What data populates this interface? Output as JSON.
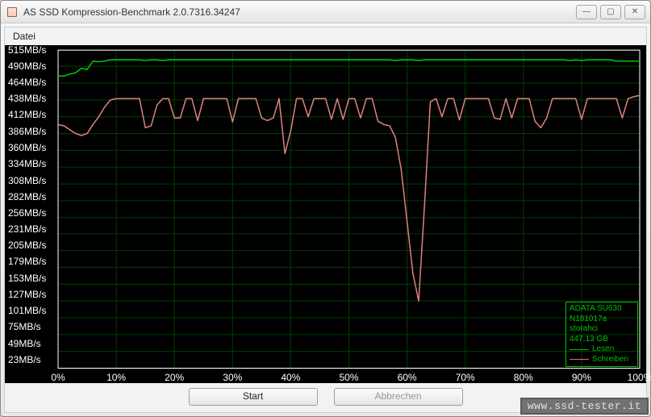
{
  "window": {
    "title": "AS SSD Kompression-Benchmark 2.0.7316.34247"
  },
  "menubar": {
    "items": [
      "Datei"
    ]
  },
  "buttons": {
    "start": "Start",
    "abort": "Abbrechen"
  },
  "legend": {
    "device": "ADATA SU630",
    "firmware": "N181017a",
    "driver": "storahci",
    "capacity": "447,13 GB",
    "read": "Lesen",
    "write": "Schreiben"
  },
  "watermark": "www.ssd-tester.it",
  "chart_data": {
    "type": "line",
    "xlabel": "",
    "ylabel": "",
    "x_ticks": [
      "0%",
      "10%",
      "20%",
      "30%",
      "40%",
      "50%",
      "60%",
      "70%",
      "80%",
      "90%",
      "100%"
    ],
    "y_ticks": [
      "23MB/s",
      "49MB/s",
      "75MB/s",
      "101MB/s",
      "127MB/s",
      "153MB/s",
      "179MB/s",
      "205MB/s",
      "231MB/s",
      "256MB/s",
      "282MB/s",
      "308MB/s",
      "334MB/s",
      "360MB/s",
      "386MB/s",
      "412MB/s",
      "438MB/s",
      "464MB/s",
      "490MB/s",
      "515MB/s"
    ],
    "xlim": [
      0,
      100
    ],
    "ylim": [
      23,
      515
    ],
    "x_step": 1,
    "series": [
      {
        "name": "Lesen",
        "color": "#00c800",
        "values": [
          475,
          475,
          478,
          480,
          487,
          485,
          498,
          497,
          498,
          500,
          500,
          500,
          500,
          500,
          500,
          499,
          500,
          500,
          499,
          500,
          500,
          500,
          500,
          500,
          500,
          500,
          500,
          500,
          500,
          500,
          500,
          500,
          500,
          500,
          500,
          500,
          500,
          500,
          500,
          500,
          500,
          500,
          500,
          500,
          500,
          500,
          500,
          500,
          500,
          500,
          500,
          500,
          500,
          500,
          500,
          500,
          500,
          500,
          499,
          500,
          500,
          500,
          499,
          500,
          500,
          500,
          500,
          500,
          500,
          500,
          500,
          500,
          500,
          500,
          500,
          500,
          500,
          500,
          500,
          500,
          500,
          500,
          500,
          500,
          500,
          500,
          500,
          500,
          499,
          500,
          499,
          500,
          500,
          500,
          500,
          500,
          498,
          498,
          498,
          498,
          498
        ]
      },
      {
        "name": "Schreiben",
        "color": "#e08080",
        "values": [
          400,
          398,
          392,
          386,
          383,
          386,
          400,
          412,
          427,
          438,
          440,
          440,
          440,
          440,
          440,
          395,
          398,
          430,
          440,
          440,
          410,
          410,
          440,
          440,
          406,
          440,
          440,
          440,
          440,
          440,
          404,
          440,
          440,
          440,
          440,
          410,
          406,
          410,
          440,
          355,
          390,
          440,
          440,
          412,
          440,
          440,
          440,
          408,
          440,
          408,
          440,
          440,
          410,
          440,
          440,
          405,
          400,
          398,
          380,
          330,
          250,
          170,
          127,
          275,
          435,
          440,
          412,
          440,
          440,
          407,
          440,
          440,
          440,
          440,
          440,
          410,
          408,
          440,
          410,
          440,
          440,
          440,
          405,
          395,
          410,
          440,
          440,
          440,
          440,
          440,
          408,
          440,
          440,
          440,
          440,
          440,
          440,
          410,
          440,
          443,
          445
        ]
      }
    ]
  }
}
